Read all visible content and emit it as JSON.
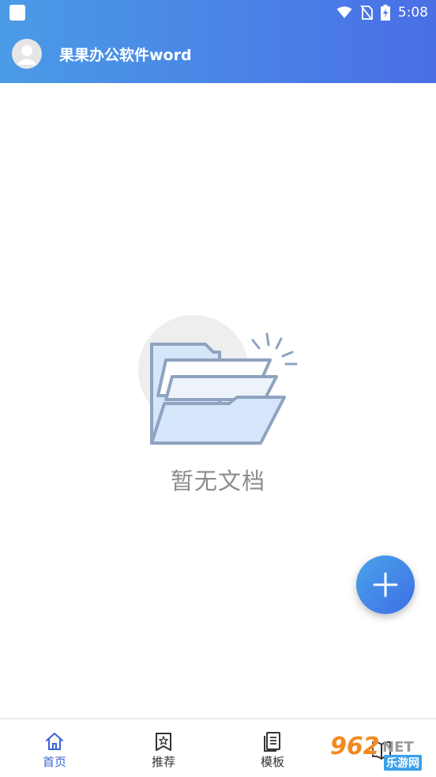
{
  "status_bar": {
    "time": "5:08",
    "icons": [
      "app-notification-icon",
      "wifi-icon",
      "no-sim-icon",
      "battery-charging-icon"
    ]
  },
  "appbar": {
    "title": "果果办公软件word",
    "avatar_icon": "user-avatar-icon",
    "gradient_start": "#4a9be6",
    "gradient_end": "#4a6fe6"
  },
  "empty_state": {
    "icon": "empty-folder-icon",
    "message": "暂无文档"
  },
  "fab": {
    "icon": "plus-icon",
    "color": "#3d6fe6"
  },
  "bottom_nav": {
    "items": [
      {
        "label": "首页",
        "icon": "home-icon",
        "active": true
      },
      {
        "label": "推荐",
        "icon": "star-bookmark-icon",
        "active": false
      },
      {
        "label": "模板",
        "icon": "template-document-icon",
        "active": false
      },
      {
        "label": "",
        "icon": "book-icon",
        "active": false
      }
    ],
    "active_color": "#3b63d6"
  },
  "watermark": {
    "main": "962",
    "suffix": "NET",
    "sub": "乐游网"
  }
}
